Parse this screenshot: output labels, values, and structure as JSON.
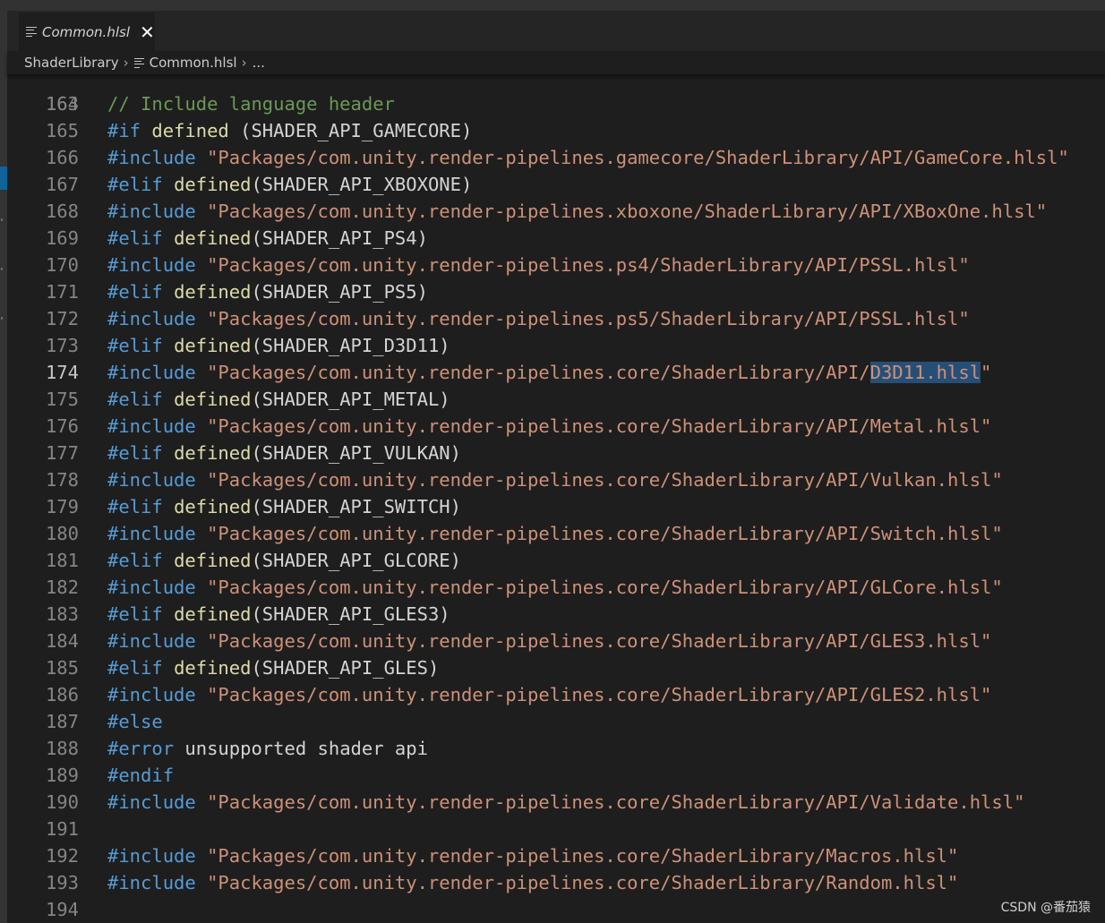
{
  "tab": {
    "label": "Common.hlsl",
    "close_glyph": "✕",
    "icon": "file-lines-icon"
  },
  "breadcrumb": {
    "folder": "ShaderLibrary",
    "file": "Common.hlsl",
    "more": "...",
    "separator": "›"
  },
  "editor": {
    "partial_top_line": "163",
    "current_line": "174",
    "lines": [
      {
        "n": "164",
        "tokens": [
          {
            "t": "// Include language header",
            "c": "cmt"
          }
        ]
      },
      {
        "n": "165",
        "tokens": [
          {
            "t": "#if",
            "c": "kw"
          },
          {
            "t": " "
          },
          {
            "t": "defined",
            "c": "fn"
          },
          {
            "t": " (SHADER_API_GAMECORE)"
          }
        ]
      },
      {
        "n": "166",
        "tokens": [
          {
            "t": "#include",
            "c": "kw"
          },
          {
            "t": " "
          },
          {
            "t": "\"Packages/com.unity.render-pipelines.gamecore/ShaderLibrary/API/GameCore.hlsl\"",
            "c": "str"
          }
        ]
      },
      {
        "n": "167",
        "tokens": [
          {
            "t": "#elif",
            "c": "kw"
          },
          {
            "t": " "
          },
          {
            "t": "defined",
            "c": "fn"
          },
          {
            "t": "(SHADER_API_XBOXONE)"
          }
        ]
      },
      {
        "n": "168",
        "tokens": [
          {
            "t": "#include",
            "c": "kw"
          },
          {
            "t": " "
          },
          {
            "t": "\"Packages/com.unity.render-pipelines.xboxone/ShaderLibrary/API/XBoxOne.hlsl\"",
            "c": "str"
          }
        ]
      },
      {
        "n": "169",
        "tokens": [
          {
            "t": "#elif",
            "c": "kw"
          },
          {
            "t": " "
          },
          {
            "t": "defined",
            "c": "fn"
          },
          {
            "t": "(SHADER_API_PS4)"
          }
        ]
      },
      {
        "n": "170",
        "tokens": [
          {
            "t": "#include",
            "c": "kw"
          },
          {
            "t": " "
          },
          {
            "t": "\"Packages/com.unity.render-pipelines.ps4/ShaderLibrary/API/PSSL.hlsl\"",
            "c": "str"
          }
        ]
      },
      {
        "n": "171",
        "tokens": [
          {
            "t": "#elif",
            "c": "kw"
          },
          {
            "t": " "
          },
          {
            "t": "defined",
            "c": "fn"
          },
          {
            "t": "(SHADER_API_PS5)"
          }
        ]
      },
      {
        "n": "172",
        "tokens": [
          {
            "t": "#include",
            "c": "kw"
          },
          {
            "t": " "
          },
          {
            "t": "\"Packages/com.unity.render-pipelines.ps5/ShaderLibrary/API/PSSL.hlsl\"",
            "c": "str"
          }
        ]
      },
      {
        "n": "173",
        "tokens": [
          {
            "t": "#elif",
            "c": "kw"
          },
          {
            "t": " "
          },
          {
            "t": "defined",
            "c": "fn"
          },
          {
            "t": "(SHADER_API_D3D11)"
          }
        ]
      },
      {
        "n": "174",
        "tokens": [
          {
            "t": "#include",
            "c": "kw"
          },
          {
            "t": " "
          },
          {
            "t": "\"Packages/com.unity.render-pipelines.core/ShaderLibrary/API/",
            "c": "str"
          },
          {
            "t": "D3D11.hlsl",
            "c": "str hl"
          },
          {
            "t": "\"",
            "c": "str"
          }
        ]
      },
      {
        "n": "175",
        "tokens": [
          {
            "t": "#elif",
            "c": "kw"
          },
          {
            "t": " "
          },
          {
            "t": "defined",
            "c": "fn"
          },
          {
            "t": "(SHADER_API_METAL)"
          }
        ]
      },
      {
        "n": "176",
        "tokens": [
          {
            "t": "#include",
            "c": "kw"
          },
          {
            "t": " "
          },
          {
            "t": "\"Packages/com.unity.render-pipelines.core/ShaderLibrary/API/Metal.hlsl\"",
            "c": "str"
          }
        ]
      },
      {
        "n": "177",
        "tokens": [
          {
            "t": "#elif",
            "c": "kw"
          },
          {
            "t": " "
          },
          {
            "t": "defined",
            "c": "fn"
          },
          {
            "t": "(SHADER_API_VULKAN)"
          }
        ]
      },
      {
        "n": "178",
        "tokens": [
          {
            "t": "#include",
            "c": "kw"
          },
          {
            "t": " "
          },
          {
            "t": "\"Packages/com.unity.render-pipelines.core/ShaderLibrary/API/Vulkan.hlsl\"",
            "c": "str"
          }
        ]
      },
      {
        "n": "179",
        "tokens": [
          {
            "t": "#elif",
            "c": "kw"
          },
          {
            "t": " "
          },
          {
            "t": "defined",
            "c": "fn"
          },
          {
            "t": "(SHADER_API_SWITCH)"
          }
        ]
      },
      {
        "n": "180",
        "tokens": [
          {
            "t": "#include",
            "c": "kw"
          },
          {
            "t": " "
          },
          {
            "t": "\"Packages/com.unity.render-pipelines.core/ShaderLibrary/API/Switch.hlsl\"",
            "c": "str"
          }
        ]
      },
      {
        "n": "181",
        "tokens": [
          {
            "t": "#elif",
            "c": "kw"
          },
          {
            "t": " "
          },
          {
            "t": "defined",
            "c": "fn"
          },
          {
            "t": "(SHADER_API_GLCORE)"
          }
        ]
      },
      {
        "n": "182",
        "tokens": [
          {
            "t": "#include",
            "c": "kw"
          },
          {
            "t": " "
          },
          {
            "t": "\"Packages/com.unity.render-pipelines.core/ShaderLibrary/API/GLCore.hlsl\"",
            "c": "str"
          }
        ]
      },
      {
        "n": "183",
        "tokens": [
          {
            "t": "#elif",
            "c": "kw"
          },
          {
            "t": " "
          },
          {
            "t": "defined",
            "c": "fn"
          },
          {
            "t": "(SHADER_API_GLES3)"
          }
        ]
      },
      {
        "n": "184",
        "tokens": [
          {
            "t": "#include",
            "c": "kw"
          },
          {
            "t": " "
          },
          {
            "t": "\"Packages/com.unity.render-pipelines.core/ShaderLibrary/API/GLES3.hlsl\"",
            "c": "str"
          }
        ]
      },
      {
        "n": "185",
        "tokens": [
          {
            "t": "#elif",
            "c": "kw"
          },
          {
            "t": " "
          },
          {
            "t": "defined",
            "c": "fn"
          },
          {
            "t": "(SHADER_API_GLES)"
          }
        ]
      },
      {
        "n": "186",
        "tokens": [
          {
            "t": "#include",
            "c": "kw"
          },
          {
            "t": " "
          },
          {
            "t": "\"Packages/com.unity.render-pipelines.core/ShaderLibrary/API/GLES2.hlsl\"",
            "c": "str"
          }
        ]
      },
      {
        "n": "187",
        "tokens": [
          {
            "t": "#else",
            "c": "kw"
          }
        ]
      },
      {
        "n": "188",
        "tokens": [
          {
            "t": "#error",
            "c": "kw"
          },
          {
            "t": " unsupported shader api"
          }
        ]
      },
      {
        "n": "189",
        "tokens": [
          {
            "t": "#endif",
            "c": "kw"
          }
        ]
      },
      {
        "n": "190",
        "tokens": [
          {
            "t": "#include",
            "c": "kw"
          },
          {
            "t": " "
          },
          {
            "t": "\"Packages/com.unity.render-pipelines.core/ShaderLibrary/API/Validate.hlsl\"",
            "c": "str"
          }
        ]
      },
      {
        "n": "191",
        "tokens": []
      },
      {
        "n": "192",
        "tokens": [
          {
            "t": "#include",
            "c": "kw"
          },
          {
            "t": " "
          },
          {
            "t": "\"Packages/com.unity.render-pipelines.core/ShaderLibrary/Macros.hlsl\"",
            "c": "str"
          }
        ]
      },
      {
        "n": "193",
        "tokens": [
          {
            "t": "#include",
            "c": "kw"
          },
          {
            "t": " "
          },
          {
            "t": "\"Packages/com.unity.render-pipelines.core/ShaderLibrary/Random.hlsl\"",
            "c": "str"
          }
        ]
      },
      {
        "n": "194",
        "tokens": []
      }
    ]
  },
  "watermark": "CSDN @番茄猿",
  "colors": {
    "background": "#1e1e1e",
    "keyword": "#569cd6",
    "function": "#dcdcaa",
    "string": "#ce9178",
    "comment": "#6a9955",
    "selection": "#264f78"
  }
}
